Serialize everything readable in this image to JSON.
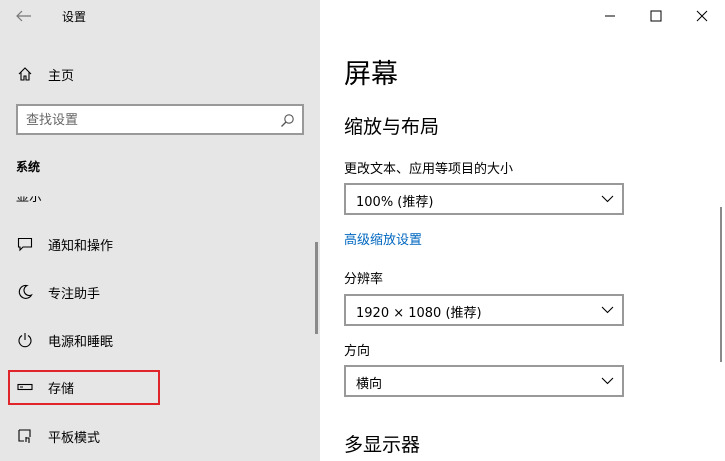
{
  "window": {
    "title": "设置",
    "controls": [
      "minimize-icon",
      "maximize-icon",
      "close-icon"
    ]
  },
  "sidebar": {
    "home_label": "主页",
    "search_placeholder": "查找设置",
    "section_title": "系统",
    "cut_off_item": "显示",
    "items": [
      {
        "label": "通知和操作",
        "icon": "notification-icon"
      },
      {
        "label": "专注助手",
        "icon": "moon-icon"
      },
      {
        "label": "电源和睡眠",
        "icon": "power-icon"
      },
      {
        "label": "存储",
        "icon": "storage-icon",
        "highlighted": true
      },
      {
        "label": "平板模式",
        "icon": "tablet-icon"
      }
    ]
  },
  "main": {
    "page_title": "屏幕",
    "scale_section": "缩放与布局",
    "scale_label": "更改文本、应用等项目的大小",
    "scale_value": "100% (推荐)",
    "advanced_link": "高级缩放设置",
    "resolution_label": "分辨率",
    "resolution_value": "1920 × 1080 (推荐)",
    "orientation_label": "方向",
    "orientation_value": "横向",
    "multi_display_section": "多显示器"
  },
  "colors": {
    "sidebar_bg": "#e6e6e6",
    "link": "#0067c0",
    "highlight_border": "#e0262b"
  }
}
